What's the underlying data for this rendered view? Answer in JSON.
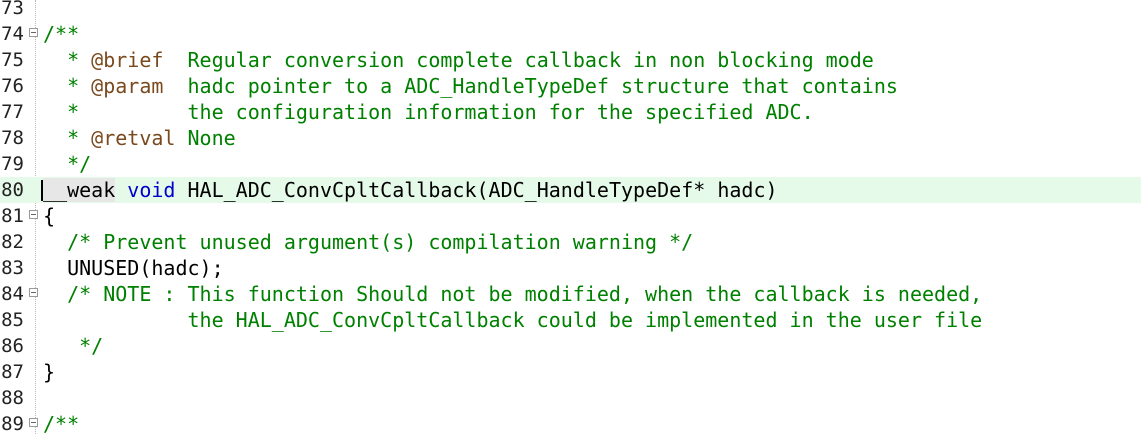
{
  "editor": {
    "lines": [
      {
        "number": "73",
        "segments": []
      },
      {
        "number": "74",
        "fold": true,
        "segments": [
          {
            "text": "/**",
            "kind": "comment"
          }
        ]
      },
      {
        "number": "75",
        "segments": [
          {
            "text": "  * ",
            "kind": "comment"
          },
          {
            "text": "@brief",
            "kind": "tag"
          },
          {
            "text": "  Regular conversion complete callback in non blocking mode",
            "kind": "comment"
          }
        ]
      },
      {
        "number": "76",
        "segments": [
          {
            "text": "  * ",
            "kind": "comment"
          },
          {
            "text": "@param",
            "kind": "tag"
          },
          {
            "text": "  hadc pointer to a ADC_HandleTypeDef structure that contains",
            "kind": "comment"
          }
        ]
      },
      {
        "number": "77",
        "segments": [
          {
            "text": "  *         the configuration information for the specified ADC.",
            "kind": "comment"
          }
        ]
      },
      {
        "number": "78",
        "segments": [
          {
            "text": "  * ",
            "kind": "comment"
          },
          {
            "text": "@retval",
            "kind": "tag"
          },
          {
            "text": " None",
            "kind": "comment"
          }
        ]
      },
      {
        "number": "79",
        "segments": [
          {
            "text": "  */",
            "kind": "comment"
          }
        ]
      },
      {
        "number": "80",
        "current": true,
        "caret": true,
        "segments": [
          {
            "text": "__weak",
            "kind": "weak"
          },
          {
            "text": " ",
            "kind": "plain"
          },
          {
            "text": "void",
            "kind": "keyword"
          },
          {
            "text": " HAL_ADC_ConvCpltCallback(ADC_HandleTypeDef* hadc)",
            "kind": "plain"
          }
        ]
      },
      {
        "number": "81",
        "fold": true,
        "segments": [
          {
            "text": "{",
            "kind": "plain"
          }
        ]
      },
      {
        "number": "82",
        "segments": [
          {
            "text": "  /* Prevent unused argument(s) compilation warning */",
            "kind": "comment"
          }
        ]
      },
      {
        "number": "83",
        "segments": [
          {
            "text": "  UNUSED(hadc);",
            "kind": "plain"
          }
        ]
      },
      {
        "number": "84",
        "fold": true,
        "segments": [
          {
            "text": "  /* NOTE : This function Should not be modified, when the callback is needed,",
            "kind": "comment"
          }
        ]
      },
      {
        "number": "85",
        "segments": [
          {
            "text": "            the HAL_ADC_ConvCpltCallback could be implemented in the user file",
            "kind": "comment"
          }
        ]
      },
      {
        "number": "86",
        "segments": [
          {
            "text": "   */",
            "kind": "comment"
          }
        ]
      },
      {
        "number": "87",
        "segments": [
          {
            "text": "}",
            "kind": "plain"
          }
        ]
      },
      {
        "number": "88",
        "segments": []
      },
      {
        "number": "89",
        "fold": true,
        "segments": [
          {
            "text": "/**",
            "kind": "comment"
          }
        ]
      }
    ]
  },
  "colors": {
    "comment": "#008000",
    "keyword": "#0000cc",
    "tag": "#7a4a1e",
    "current_line": "#e6fae9"
  }
}
